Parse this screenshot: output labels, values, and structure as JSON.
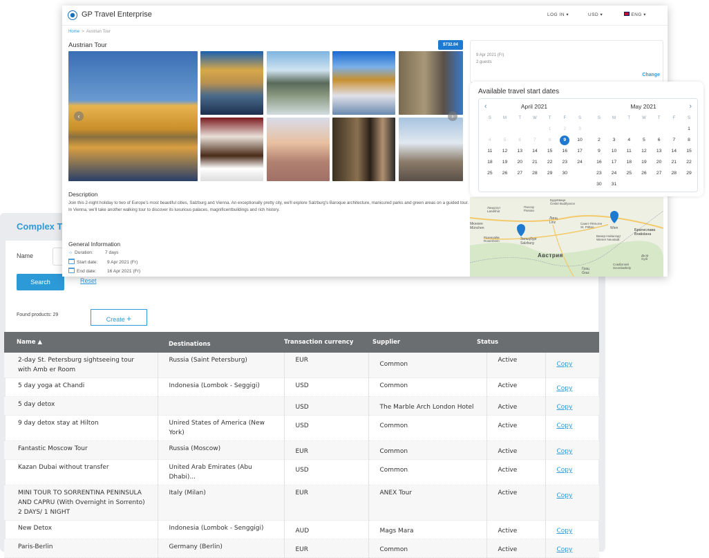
{
  "back_panel": {
    "title": "Complex Tou",
    "name_label": "Name",
    "name_value": "",
    "search_label": "Search",
    "reset_label": "Reset",
    "found_label": "Found products: 29",
    "create_label": "Create",
    "create_icon": "plus-icon",
    "table": {
      "columns": [
        "Name",
        "Destinations",
        "Transaction currency",
        "Supplier",
        "Status",
        ""
      ],
      "sort_column": "Name",
      "sort_direction": "ascending",
      "copy_label": "Copy",
      "rows": [
        {
          "name": "2-day St. Petersburg sightseeing tour with Amb er Room",
          "dest": "Russia (Saint Petersburg)",
          "cur": "EUR",
          "supplier": "Common",
          "status": "Active"
        },
        {
          "name": "5 day yoga at Chandi",
          "dest": "Indonesia (Lombok - Seggigi)",
          "cur": "USD",
          "supplier": "Common",
          "status": "Active"
        },
        {
          "name": "5 day detox",
          "dest": "",
          "cur": "USD",
          "supplier": "The Marble Arch London Hotel",
          "status": "Active"
        },
        {
          "name": "9 day detox stay at Hilton",
          "dest": "Unired States of America (New York)",
          "cur": "USD",
          "supplier": "Common",
          "status": "Active"
        },
        {
          "name": "Fantastic Moscow Tour",
          "dest": "Russia (Moscow)",
          "cur": "EUR",
          "supplier": "Common",
          "status": "Active"
        },
        {
          "name": "Kazan Dubai without transfer",
          "dest": "United Arab Emirates (Abu Dhabi)...",
          "cur": "USD",
          "supplier": "Common",
          "status": "Active"
        },
        {
          "name": "MINI TOUR TO SORRENTINA PENINSULA AND CAPRU (With Overnight in Sorrento) 2 DAYS/ 1 NIGHT",
          "dest": "Italy (Milan)",
          "cur": "EUR",
          "supplier": "ANEX Tour",
          "status": "Active"
        },
        {
          "name": "New Detox",
          "dest": "Indonesia (Lombok  - Senggigi)",
          "cur": "AUD",
          "supplier": "Mags Mara",
          "status": "Active"
        },
        {
          "name": "Paris-Berlin",
          "dest": "Germany (Berlin)",
          "cur": "EUR",
          "supplier": "Common",
          "status": "Active"
        }
      ]
    }
  },
  "front_panel": {
    "brand": "GP Travel Enterprise",
    "nav": {
      "login": "LOG IN",
      "currency": "USD",
      "language": "ENG"
    },
    "breadcrumb": {
      "home": "Home",
      "sep": ">",
      "current": "Austrian Tour"
    },
    "title": "Austrian Tour",
    "price": "$732.04",
    "description_heading": "Description",
    "description": "Join this 2-night holiday to two of Europe's most beautiful cities, Salzburg and Vienna. An exceptionally pretty city, we'll explore Salzburg's Baroque architecture, manicured parks and green areas on a guided tour. In Vienna, we'll take another walking tour to discover its luxurious palaces, magnificentbuildings and rich history.",
    "general_heading": "General Information",
    "general": [
      {
        "icon": "sun-icon",
        "label": "Duration:",
        "value": "7 days"
      },
      {
        "icon": "calendar-icon",
        "label": "Start date:",
        "value": "9 Apr 2021 (Fr)"
      },
      {
        "icon": "calendar-icon",
        "label": "End date:",
        "value": "16 Apr 2021 (Fr)"
      }
    ],
    "booking": {
      "date": "9 Apr 2021 (Fr)",
      "guests": "2 guests",
      "change": "Change"
    },
    "map_labels": {
      "austria": "Австрия",
      "salzburg": "Зальцбург\nSalzburg",
      "vienna": "Wien",
      "bratislava": "Братислава\nBratislava",
      "munchen": "Мюнхен\nMünchen",
      "linz": "Линц\nLinz",
      "graz": "Грац\nGraz",
      "stpolten": "Санкт-Пёльтен\nSt. Pölten",
      "passau": "Пассау\nPassau",
      "budejovice": "Будеёвице\nČeské Budějovice",
      "rosenheim": "Розенхайм\nRosenheim",
      "wnstadt": "Винер-Нойштадт\nWiener Neustadt",
      "gyor": "Дьор\nGyőr",
      "szombathely": "Сомбатхей\nSzombathely",
      "landshut": "Ландсхут\nLandshut"
    }
  },
  "calendar": {
    "heading": "Available travel start dates",
    "weekdays": [
      "S",
      "M",
      "T",
      "W",
      "T",
      "F",
      "S"
    ],
    "selected": "9 April 2021",
    "accent": "#1d7ad0",
    "months": [
      {
        "title": "April 2021",
        "disabled_before": 9,
        "selected": 9,
        "weeks": [
          [
            null,
            null,
            null,
            null,
            1,
            2,
            3
          ],
          [
            4,
            5,
            6,
            7,
            8,
            9,
            10
          ],
          [
            11,
            12,
            13,
            14,
            15,
            16,
            17
          ],
          [
            18,
            19,
            20,
            21,
            22,
            23,
            24
          ],
          [
            25,
            26,
            27,
            28,
            29,
            30,
            null
          ]
        ]
      },
      {
        "title": "May 2021",
        "disabled_before": 0,
        "selected": null,
        "weeks": [
          [
            null,
            null,
            null,
            null,
            null,
            null,
            1
          ],
          [
            2,
            3,
            4,
            5,
            6,
            7,
            8
          ],
          [
            9,
            10,
            11,
            12,
            13,
            14,
            15
          ],
          [
            16,
            17,
            18,
            19,
            20,
            21,
            22
          ],
          [
            23,
            24,
            25,
            26,
            27,
            28,
            29
          ],
          [
            30,
            31,
            null,
            null,
            null,
            null,
            null
          ]
        ]
      }
    ]
  },
  "colors": {
    "accent": "#2d9ad8",
    "table_header": "#6b6e70",
    "panel_bg": "#e9ebee"
  }
}
